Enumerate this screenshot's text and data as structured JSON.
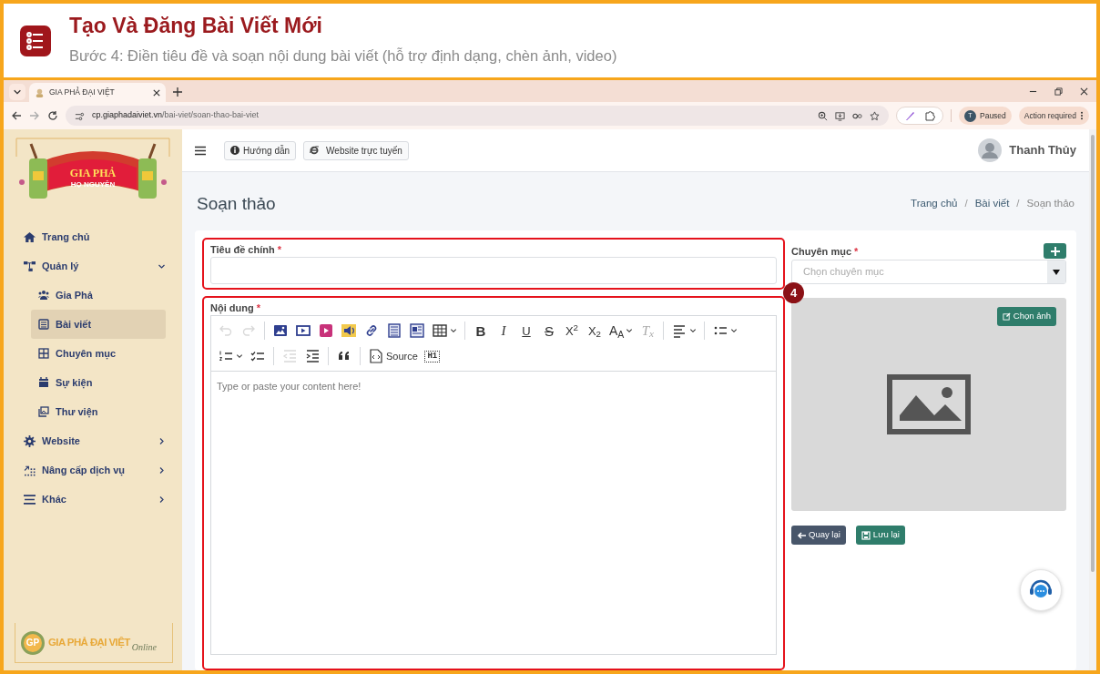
{
  "header": {
    "title": "Tạo Và Đăng Bài Viết Mới",
    "subtitle": "Bước 4: Điền tiêu đề và soạn nội dung bài viết (hỗ trợ định dạng, chèn ảnh, video)"
  },
  "browser": {
    "tab": {
      "title": "GIA PHẢ ĐẠI VIỆT",
      "selected": true
    },
    "address": {
      "domain": "cp.giaphadaiviet.vn",
      "path": "/bai-viet/soan-thao-bai-viet"
    },
    "profile": {
      "initial": "T",
      "status": "Paused"
    },
    "action_chip": "Action required"
  },
  "sidebar": {
    "logo": {
      "title": "GIA PHẢ",
      "subtitle": "HỌ NGUYỄN"
    },
    "items": [
      {
        "label": "Trang chủ",
        "selected": false
      },
      {
        "label": "Quản lý",
        "selected": false,
        "expanded": true,
        "children": [
          {
            "label": "Gia Phả",
            "selected": false
          },
          {
            "label": "Bài viết",
            "selected": true
          },
          {
            "label": "Chuyên mục",
            "selected": false
          },
          {
            "label": "Sự kiện",
            "selected": false
          },
          {
            "label": "Thư viện",
            "selected": false
          }
        ]
      },
      {
        "label": "Website",
        "selected": false,
        "expanded": false
      },
      {
        "label": "Nâng cấp dịch vụ",
        "selected": false,
        "expanded": false
      },
      {
        "label": "Khác",
        "selected": false,
        "expanded": false
      }
    ],
    "footer_logo": {
      "mark": "GP",
      "name": "GIA PHẢ ĐẠI VIỆT",
      "tagline": "Online"
    }
  },
  "topbar": {
    "buttons": [
      {
        "label": "Hướng dẫn"
      },
      {
        "label": "Website trực tuyến"
      }
    ],
    "user": "Thanh Thủy"
  },
  "page": {
    "title": "Soạn thảo",
    "breadcrumb": {
      "separator": "/",
      "items": [
        {
          "label": "Trang chủ",
          "current": false
        },
        {
          "label": "Bài viết",
          "current": false
        },
        {
          "label": "Soạn thảo",
          "current": true
        }
      ]
    }
  },
  "form": {
    "title_field": {
      "label": "Tiêu đề chính",
      "required_mark": "*",
      "highlighted": true
    },
    "content": {
      "label": "Nội dung",
      "required_mark": "*",
      "highlighted": true,
      "placeholder": "Type or paste your content here!",
      "toolbar": [
        [
          {
            "kind": "undo",
            "disabled": true,
            "dropdown": false
          },
          {
            "kind": "redo",
            "disabled": true,
            "dropdown": false
          },
          {
            "kind": "separator"
          },
          {
            "kind": "image",
            "disabled": false,
            "dropdown": false
          },
          {
            "kind": "video",
            "disabled": false,
            "dropdown": false
          },
          {
            "kind": "youtube",
            "disabled": false,
            "dropdown": false
          },
          {
            "kind": "audio",
            "disabled": false,
            "dropdown": false
          },
          {
            "kind": "link",
            "disabled": false,
            "dropdown": false
          },
          {
            "kind": "embed",
            "disabled": false,
            "dropdown": false
          },
          {
            "kind": "news",
            "disabled": false,
            "dropdown": false
          },
          {
            "kind": "table",
            "disabled": false,
            "dropdown": true
          },
          {
            "kind": "separator"
          },
          {
            "kind": "bold",
            "glyph": "B",
            "disabled": false,
            "dropdown": false
          },
          {
            "kind": "italic",
            "glyph": "I",
            "disabled": false,
            "dropdown": false
          },
          {
            "kind": "underline",
            "glyph": "U",
            "disabled": false,
            "dropdown": false
          },
          {
            "kind": "strike",
            "glyph": "S",
            "disabled": false,
            "dropdown": false
          },
          {
            "kind": "superscript",
            "glyph": "X$^{2}$",
            "disabled": false,
            "dropdown": false
          },
          {
            "kind": "subscript",
            "glyph": "X$_{2}$",
            "disabled": false,
            "dropdown": false
          },
          {
            "kind": "font_size",
            "glyph": "A$_{A}$",
            "disabled": false,
            "dropdown": true
          },
          {
            "kind": "clear_format",
            "glyph": "T$_{x}$",
            "disabled": true,
            "dropdown": false
          },
          {
            "kind": "separator"
          },
          {
            "kind": "align",
            "disabled": false,
            "dropdown": true
          },
          {
            "kind": "separator"
          },
          {
            "kind": "bulleted_list",
            "disabled": false,
            "dropdown": true
          }
        ],
        [
          {
            "kind": "numbered_list",
            "disabled": false,
            "dropdown": true
          },
          {
            "kind": "todo_list",
            "disabled": false,
            "dropdown": false
          },
          {
            "kind": "separator"
          },
          {
            "kind": "outdent",
            "disabled": true,
            "dropdown": false
          },
          {
            "kind": "indent",
            "disabled": false,
            "dropdown": false
          },
          {
            "kind": "separator"
          },
          {
            "kind": "blockquote",
            "disabled": false,
            "dropdown": false
          },
          {
            "kind": "separator"
          },
          {
            "kind": "source",
            "label": "Source",
            "disabled": false,
            "dropdown": false
          },
          {
            "kind": "heading",
            "glyph": "H1",
            "disabled": false,
            "dropdown": false
          }
        ]
      ]
    },
    "category": {
      "label": "Chuyên mục",
      "required_mark": "*",
      "placeholder": "Chọn chuyên mục"
    },
    "image": {
      "button": "Chọn ảnh"
    },
    "actions": [
      {
        "label": "Quay lại",
        "kind": "back"
      },
      {
        "label": "Lưu lại",
        "kind": "save"
      }
    ]
  },
  "step_badge": "4"
}
